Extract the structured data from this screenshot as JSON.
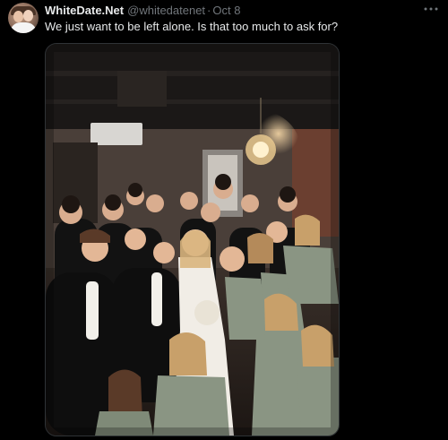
{
  "tweet": {
    "display_name": "WhiteDate.Net",
    "handle": "@whitedatenet",
    "separator": "·",
    "time": "Oct 8",
    "text": "We just want to be left alone. Is that too much to ask for?",
    "avatar_icon": "profile-avatar",
    "more_icon": "more-dots-icon",
    "media": {
      "icon": "wedding-party-photo"
    }
  },
  "colors": {
    "background": "#000000",
    "primary_text": "#e7e9ea",
    "secondary_text": "#71767b",
    "border": "#2f3336"
  }
}
